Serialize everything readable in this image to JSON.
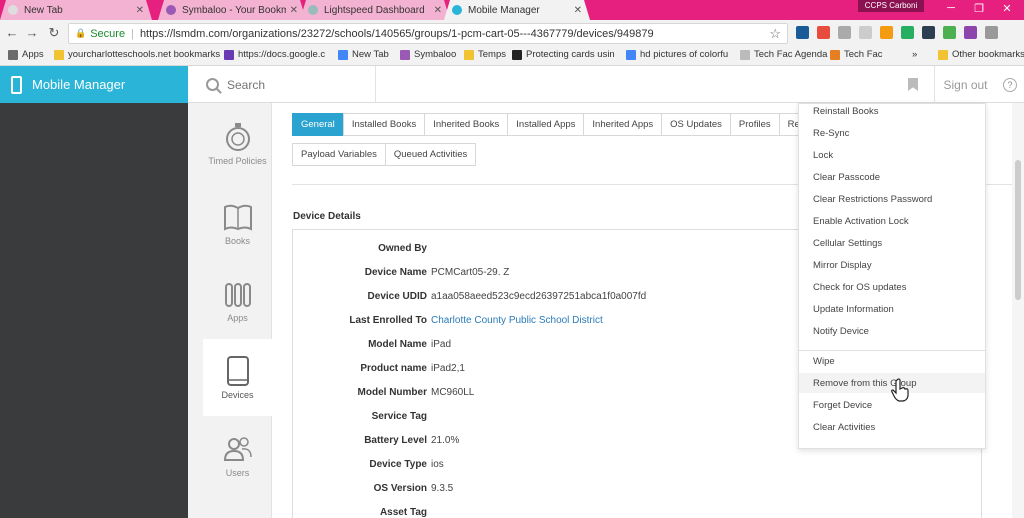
{
  "browser": {
    "tabs": [
      {
        "label": "New Tab",
        "icon_color": "#ddd"
      },
      {
        "label": "Symbaloo - Your Bookm",
        "icon_color": "#9b59b6"
      },
      {
        "label": "Lightspeed Dashboard",
        "icon_color": "#9bb"
      },
      {
        "label": "Mobile Manager",
        "icon_color": "#2ab5d8"
      }
    ],
    "profile": "CCPS Carboni",
    "address": {
      "secure_label": "Secure",
      "url": "https://lsmdm.com/organizations/23272/schools/140565/groups/1-pcm-cart-05---4367779/devices/949879"
    },
    "bookmarks": [
      {
        "label": "Apps",
        "icon_color": "#6b6b6b"
      },
      {
        "label": "yourcharlotteschools.net bookmarks",
        "icon_color": "#f1c232"
      },
      {
        "label": "https://docs.google.c",
        "icon_color": "#6a3ab5"
      },
      {
        "label": "New Tab",
        "icon_color": "#4285f4"
      },
      {
        "label": "Symbaloo",
        "icon_color": "#9b59b6"
      },
      {
        "label": "Temps",
        "icon_color": "#f1c232"
      },
      {
        "label": "Protecting cards usin",
        "icon_color": "#222"
      },
      {
        "label": "hd pictures of colorfu",
        "icon_color": "#4285f4"
      },
      {
        "label": "Tech Fac Agenda",
        "icon_color": "#bbb"
      },
      {
        "label": "Tech Fac",
        "icon_color": "#e67e22"
      }
    ],
    "more_label": "»",
    "other_bookmarks": "Other bookmarks",
    "extension_colors": [
      "#1a5a96",
      "#e74c3c",
      "#aaa",
      "#ccc",
      "#f39c12",
      "#27ae60",
      "#2c3e50",
      "#4caf50",
      "#8e44ad",
      "#999"
    ]
  },
  "app": {
    "title": "Mobile Manager",
    "search_placeholder": "Search",
    "sign_out": "Sign out",
    "help": "?",
    "brand_color": "#2ab5d8"
  },
  "rail": [
    {
      "label": "Timed Policies",
      "icon": "stopwatch-icon"
    },
    {
      "label": "Books",
      "icon": "book-icon"
    },
    {
      "label": "Apps",
      "icon": "apps-icon"
    },
    {
      "label": "Devices",
      "icon": "tablet-icon",
      "active": true
    },
    {
      "label": "Users",
      "icon": "users-icon"
    }
  ],
  "content": {
    "tabs": [
      "General",
      "Installed Books",
      "Inherited Books",
      "Installed Apps",
      "Inherited Apps",
      "OS Updates",
      "Profiles",
      "Restri"
    ],
    "tabs2": [
      "Payload Variables",
      "Queued Activities"
    ],
    "section_title": "Device Details",
    "details": [
      {
        "label": "Owned By",
        "value": ""
      },
      {
        "label": "Device Name",
        "value": "PCMCart05-29. Z"
      },
      {
        "label": "Device UDID",
        "value": "a1aa058aeed523c9ecd26397251abca1f0a007fd"
      },
      {
        "label": "Last Enrolled To",
        "value": "Charlotte County Public School District",
        "link": true
      },
      {
        "label": "Model Name",
        "value": "iPad"
      },
      {
        "label": "Product name",
        "value": "iPad2,1"
      },
      {
        "label": "Model Number",
        "value": "MC960LL"
      },
      {
        "label": "Service Tag",
        "value": ""
      },
      {
        "label": "Battery Level",
        "value": "21.0%"
      },
      {
        "label": "Device Type",
        "value": "ios"
      },
      {
        "label": "OS Version",
        "value": "9.3.5"
      },
      {
        "label": "Asset Tag",
        "value": ""
      }
    ]
  },
  "menu": {
    "group1": [
      "Reinstall Books",
      "Re-Sync",
      "Lock",
      "Clear Passcode",
      "Clear Restrictions Password",
      "Enable Activation Lock",
      "Cellular Settings",
      "Mirror Display",
      "Check for OS updates",
      "Update Information",
      "Notify Device"
    ],
    "group2": [
      "Wipe",
      "Remove from this Group",
      "Forget Device",
      "Clear Activities"
    ]
  }
}
